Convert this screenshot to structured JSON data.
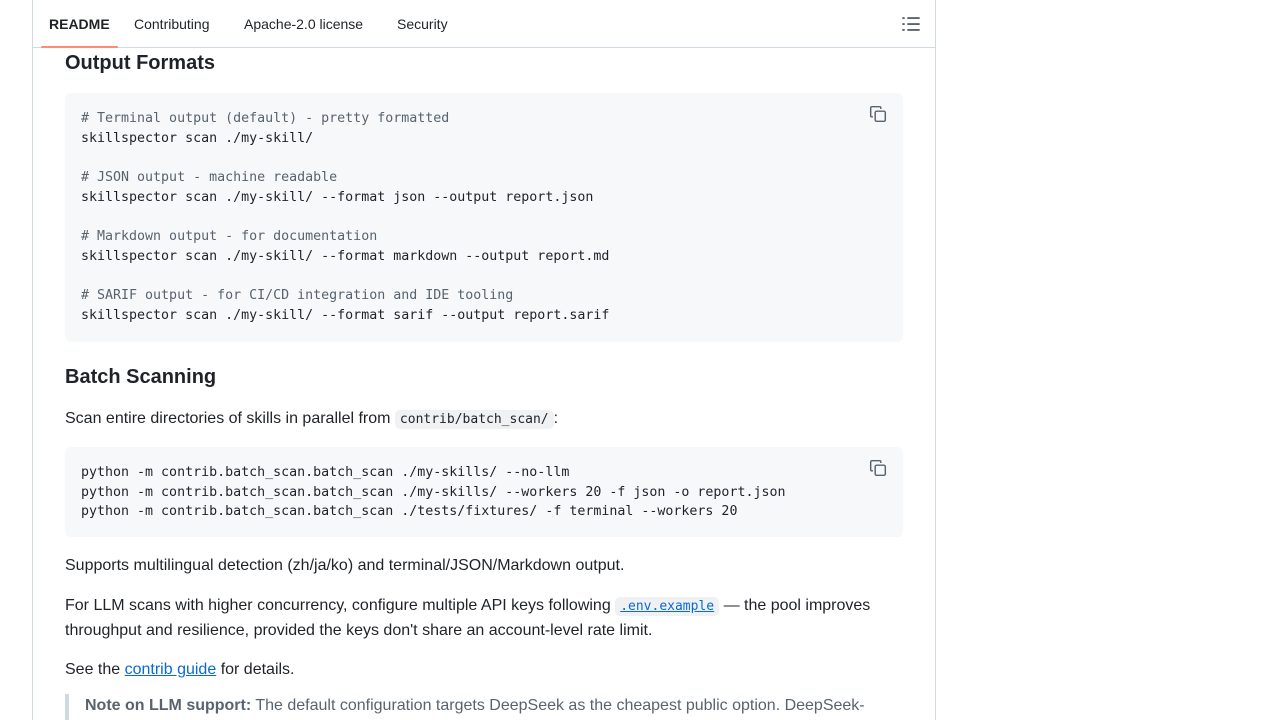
{
  "tabs": [
    {
      "label": "README",
      "active": true
    },
    {
      "label": "Contributing",
      "active": false
    },
    {
      "label": "Apache-2.0 license",
      "active": false
    },
    {
      "label": "Security",
      "active": false
    }
  ],
  "toc_icon": "list-unordered-icon",
  "copy_icon": "copy-icon",
  "sections": {
    "output_formats": {
      "heading": "Output Formats",
      "code": [
        {
          "text": "# Terminal output (default) - pretty formatted",
          "kind": "comment"
        },
        {
          "text": "skillspector scan ./my-skill/",
          "kind": "code"
        },
        {
          "text": "",
          "kind": "blank"
        },
        {
          "text": "# JSON output - machine readable",
          "kind": "comment"
        },
        {
          "text": "skillspector scan ./my-skill/ --format json --output report.json",
          "kind": "code"
        },
        {
          "text": "",
          "kind": "blank"
        },
        {
          "text": "# Markdown output - for documentation",
          "kind": "comment"
        },
        {
          "text": "skillspector scan ./my-skill/ --format markdown --output report.md",
          "kind": "code"
        },
        {
          "text": "",
          "kind": "blank"
        },
        {
          "text": "# SARIF output - for CI/CD integration and IDE tooling",
          "kind": "comment"
        },
        {
          "text": "skillspector scan ./my-skill/ --format sarif --output report.sarif",
          "kind": "code"
        }
      ]
    },
    "batch_scanning": {
      "heading": "Batch Scanning",
      "intro_prefix": "Scan entire directories of skills in parallel from",
      "intro_code": "contrib/batch_scan/",
      "intro_suffix": ":",
      "code": [
        {
          "text": "python -m contrib.batch_scan.batch_scan ./my-skills/ --no-llm",
          "kind": "code"
        },
        {
          "text": "python -m contrib.batch_scan.batch_scan ./my-skills/ --workers 20 -f json -o report.json",
          "kind": "code"
        },
        {
          "text": "python -m contrib.batch_scan.batch_scan ./tests/fixtures/ -f terminal --workers 20",
          "kind": "code"
        }
      ],
      "supports_text": "Supports multilingual detection (zh/ja/ko) and terminal/JSON/Markdown output.",
      "llm_prefix": "For LLM scans with higher concurrency, configure multiple API keys following",
      "llm_link": ".env.example",
      "llm_suffix": "— the pool improves throughput and resilience, provided the keys don't share an account-level rate limit.",
      "see_prefix": "See the",
      "see_link": "contrib guide",
      "see_suffix": "for details."
    },
    "note": {
      "label": "Note on LLM support:",
      "text": "The default configuration targets DeepSeek as the cheapest public option. DeepSeek-"
    }
  }
}
